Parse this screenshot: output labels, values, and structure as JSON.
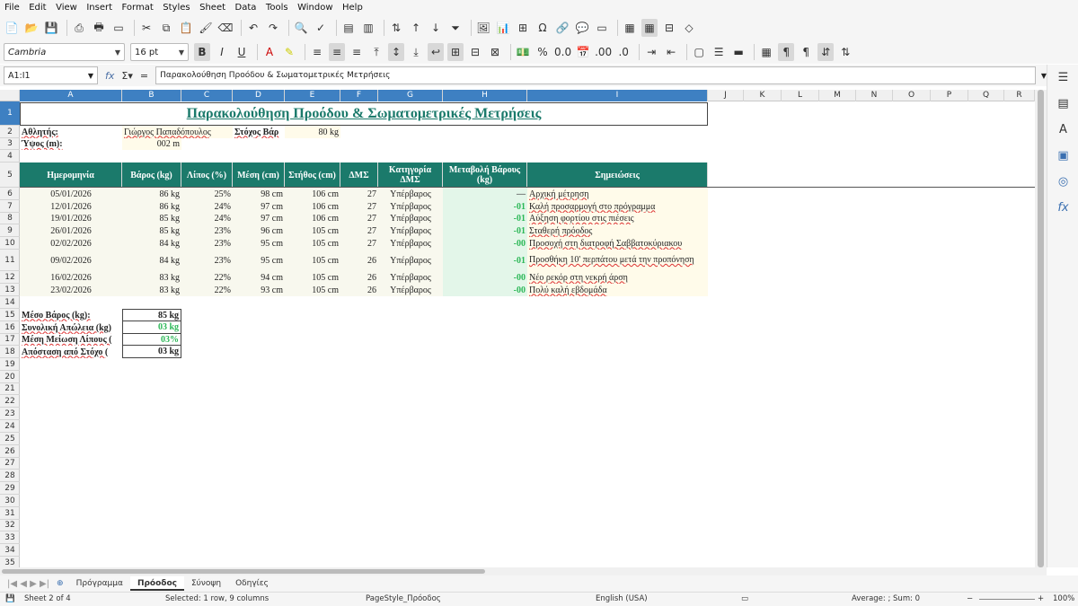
{
  "menu": [
    "File",
    "Edit",
    "View",
    "Insert",
    "Format",
    "Styles",
    "Sheet",
    "Data",
    "Tools",
    "Window",
    "Help"
  ],
  "toolbar": {
    "font_name": "Cambria",
    "font_size": "16 pt"
  },
  "formula_bar": {
    "cell_ref": "A1:I1",
    "content": "Παρακολούθηση Προόδου & Σωματομετρικές Μετρήσεις"
  },
  "columns": [
    "A",
    "B",
    "C",
    "D",
    "E",
    "F",
    "G",
    "H",
    "I",
    "J",
    "K",
    "L",
    "M",
    "N",
    "O",
    "P",
    "Q",
    "R"
  ],
  "rows": [
    "1",
    "2",
    "3",
    "4",
    "5",
    "6",
    "7",
    "8",
    "9",
    "10",
    "11",
    "12",
    "13",
    "14",
    "15",
    "16",
    "17",
    "18",
    "19",
    "20",
    "21",
    "22",
    "23",
    "24",
    "25",
    "26",
    "27",
    "28",
    "29",
    "30",
    "31",
    "32",
    "33",
    "34",
    "35"
  ],
  "sheet": {
    "title": "Παρακολούθηση Προόδου & Σωματομετρικές Μετρήσεις",
    "athlete_label": "Αθλητής:",
    "athlete_name": "Γιώργος Παπαδόπουλος",
    "target_label": "Στόχος Βάρ",
    "target_value": "80 kg",
    "height_label": "Ύψος (m):",
    "height_value": "002 m",
    "headers": [
      "Ημερομηνία",
      "Βάρος (kg)",
      "Λίπος (%)",
      "Μέση (cm)",
      "Στήθος (cm)",
      "ΔΜΣ",
      "Κατηγορία ΔΜΣ",
      "Μεταβολή Βάρους (kg)",
      "Σημειώσεις"
    ],
    "data": [
      [
        "05/01/2026",
        "86 kg",
        "25%",
        "98 cm",
        "106 cm",
        "27",
        "Υπέρβαρος",
        "—",
        "Αρχική μέτρηση"
      ],
      [
        "12/01/2026",
        "86 kg",
        "24%",
        "97 cm",
        "106 cm",
        "27",
        "Υπέρβαρος",
        "-01",
        "Καλή προσαρμογή στο πρόγραμμα"
      ],
      [
        "19/01/2026",
        "85 kg",
        "24%",
        "97 cm",
        "106 cm",
        "27",
        "Υπέρβαρος",
        "-01",
        "Αύξηση φορτίου στις πιέσεις"
      ],
      [
        "26/01/2026",
        "85 kg",
        "23%",
        "96 cm",
        "105 cm",
        "27",
        "Υπέρβαρος",
        "-01",
        "Σταθερή πρόοδος"
      ],
      [
        "02/02/2026",
        "84 kg",
        "23%",
        "95 cm",
        "105 cm",
        "27",
        "Υπέρβαρος",
        "-00",
        "Προσοχή στη διατροφή Σαββατοκύριακου"
      ],
      [
        "09/02/2026",
        "84 kg",
        "23%",
        "95 cm",
        "105 cm",
        "26",
        "Υπέρβαρος",
        "-01",
        "Προσθήκη 10' περπάτου μετά την προπόνηση"
      ],
      [
        "16/02/2026",
        "83 kg",
        "22%",
        "94 cm",
        "105 cm",
        "26",
        "Υπέρβαρος",
        "-00",
        "Νέο ρεκόρ στη νεκρή άρση"
      ],
      [
        "23/02/2026",
        "83 kg",
        "22%",
        "93 cm",
        "105 cm",
        "26",
        "Υπέρβαρος",
        "-00",
        "Πολύ καλή εβδομάδα"
      ]
    ],
    "summary": [
      {
        "label": "Μέσο Βάρος (kg):",
        "value": "85 kg"
      },
      {
        "label": "Συνολική Απώλεια (kg)",
        "value": "03 kg"
      },
      {
        "label": "Μέση Μείωση Λίπους (",
        "value": "03%"
      },
      {
        "label": "Απόσταση από Στόχο (",
        "value": "03 kg"
      }
    ]
  },
  "tabs": [
    "Πρόγραμμα",
    "Πρόοδος",
    "Σύνοψη",
    "Οδηγίες"
  ],
  "active_tab": "Πρόοδος",
  "status": {
    "sheet": "Sheet 2 of 4",
    "selection": "Selected: 1 row, 9 columns",
    "pagestyle": "PageStyle_Πρόοδος",
    "lang": "English (USA)",
    "calc": "Average: ; Sum: 0",
    "zoom": "100%"
  }
}
